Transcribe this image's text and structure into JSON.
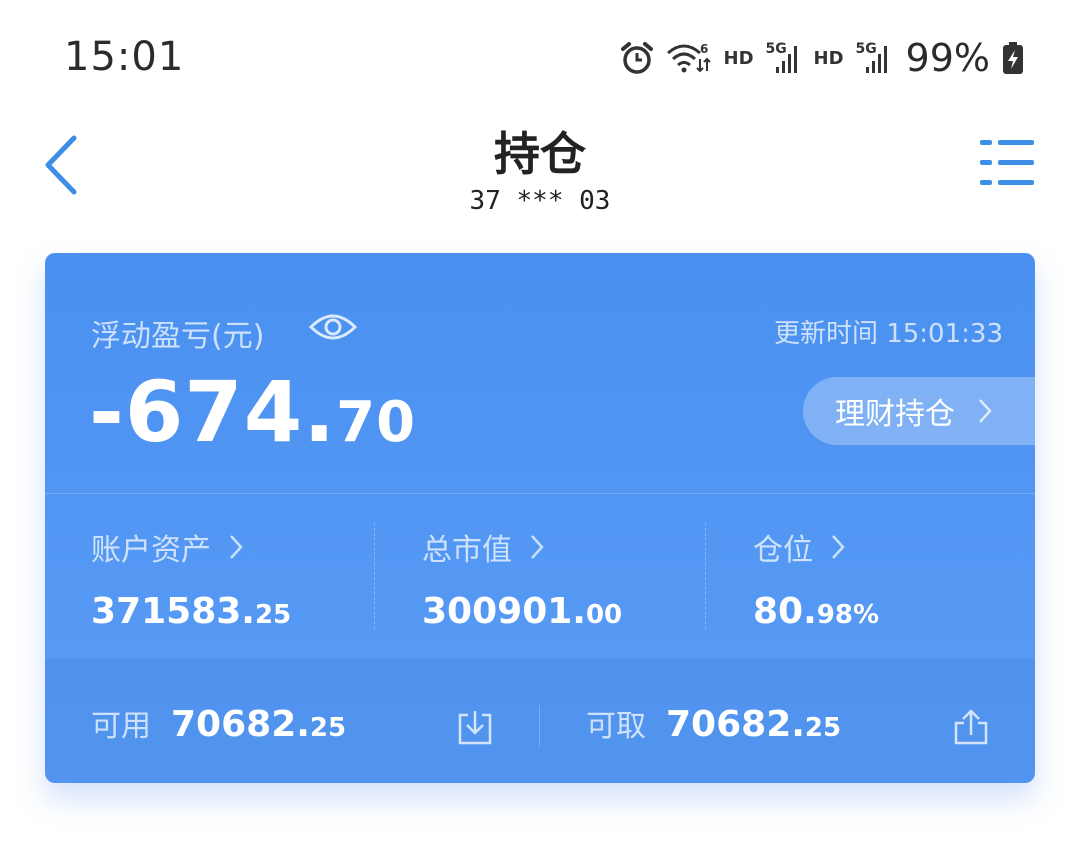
{
  "status_bar": {
    "time": "15:01",
    "hd1": "HD",
    "net1": "5G",
    "hd2": "HD",
    "net2": "5G",
    "battery": "99%",
    "icons": [
      "alarm-icon",
      "wifi6-icon",
      "signal-icon",
      "signal-icon",
      "battery-charging-icon"
    ]
  },
  "nav": {
    "title": "持仓",
    "account": "37 *** 03",
    "back_icon": "chevron-left-icon",
    "menu_icon": "list-menu-icon"
  },
  "card": {
    "pnl_label": "浮动盈亏(元)",
    "update_label": "更新时间 15:01:33",
    "pnl_int": "-674.",
    "pnl_dec": "70",
    "wealth_label": "理财持仓",
    "metrics": [
      {
        "label": "账户资产",
        "int": "371583.",
        "dec": "25"
      },
      {
        "label": "总市值",
        "int": "300901.",
        "dec": "00"
      },
      {
        "label": "仓位",
        "int": "80.",
        "dec": "98%"
      }
    ],
    "available": {
      "label": "可用",
      "int": "70682.",
      "dec": "25"
    },
    "withdrawable": {
      "label": "可取",
      "int": "70682.",
      "dec": "25"
    }
  },
  "colors": {
    "accent": "#3d8ee6",
    "card_top": "#4a90f0",
    "card_bottom": "#5a9df6"
  }
}
